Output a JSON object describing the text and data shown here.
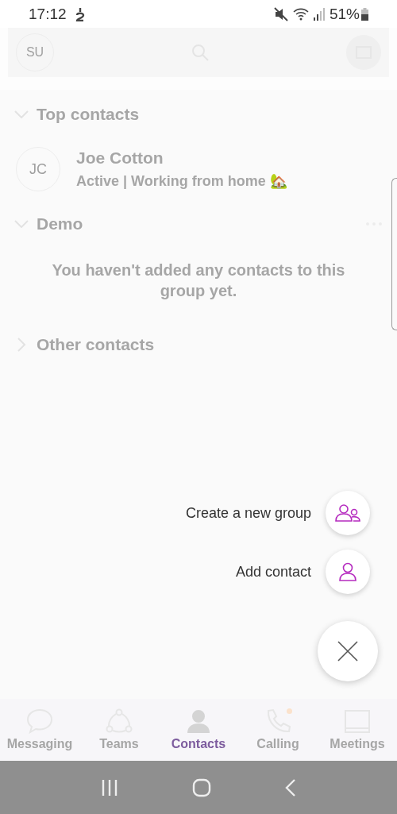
{
  "status_bar": {
    "time": "17:12",
    "battery": "51%"
  },
  "top_bar": {
    "avatar_initials": "SU"
  },
  "sections": [
    {
      "title": "Top contacts",
      "expanded": true,
      "contacts": [
        {
          "initials": "JC",
          "name": "Joe Cotton",
          "status": "Active | Working from home 🏡"
        }
      ]
    },
    {
      "title": "Demo",
      "expanded": true,
      "empty_message": "You haven't added any contacts to this group yet."
    },
    {
      "title": "Other contacts",
      "expanded": false
    }
  ],
  "actions": [
    {
      "label": "Create a new group",
      "kind": "group"
    },
    {
      "label": "Add contact",
      "kind": "contact"
    }
  ],
  "nav": [
    {
      "label": "Messaging",
      "kind": "chat",
      "selected": false,
      "notification": false
    },
    {
      "label": "Teams",
      "kind": "teams",
      "selected": false,
      "notification": false
    },
    {
      "label": "Contacts",
      "kind": "person",
      "selected": true,
      "notification": false
    },
    {
      "label": "Calling",
      "kind": "phone",
      "selected": false,
      "notification": true
    },
    {
      "label": "Meetings",
      "kind": "calendar",
      "selected": false,
      "notification": false
    }
  ]
}
